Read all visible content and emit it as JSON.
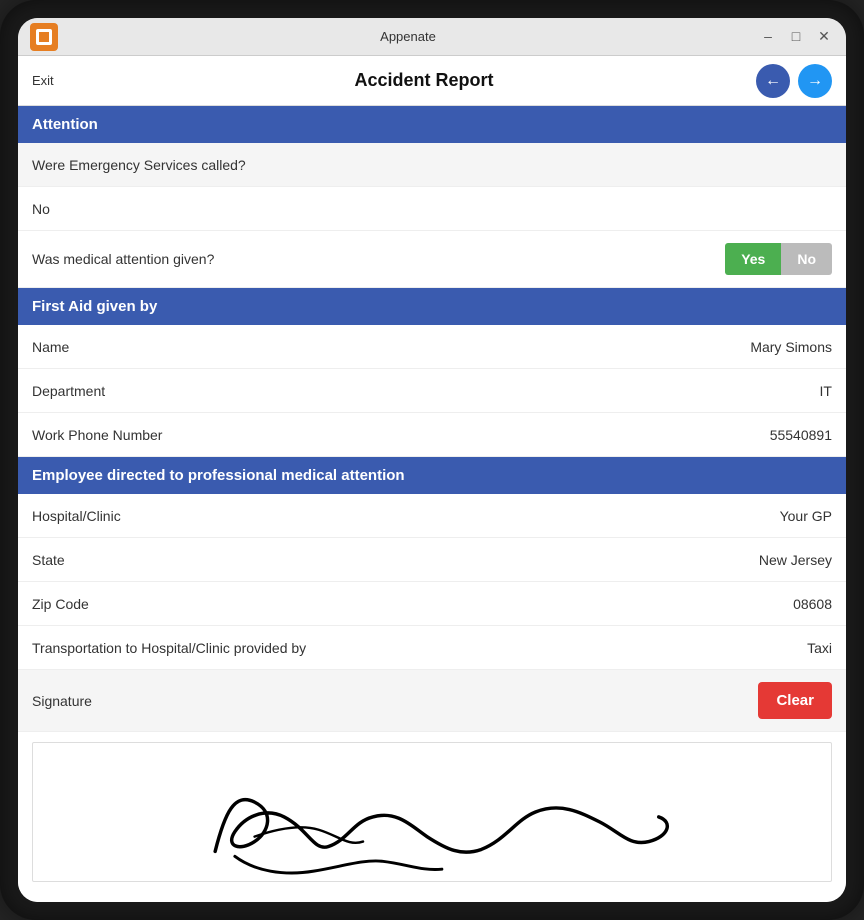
{
  "titleBar": {
    "appName": "Appenate",
    "controls": {
      "minimize": "–",
      "maximize": "□",
      "close": "✕"
    }
  },
  "appHeader": {
    "exitLabel": "Exit",
    "title": "Accident Report",
    "prevArrow": "←",
    "nextArrow": "→"
  },
  "sections": [
    {
      "id": "attention",
      "header": "Attention",
      "fields": [
        {
          "id": "emergency-services",
          "label": "Were Emergency Services called?",
          "value": "No",
          "type": "text",
          "shaded": true
        },
        {
          "id": "medical-attention",
          "label": "Was medical attention given?",
          "value": null,
          "type": "yesno",
          "yesLabel": "Yes",
          "noLabel": "No",
          "selected": "yes",
          "shaded": false
        }
      ]
    },
    {
      "id": "first-aid",
      "header": "First Aid given by",
      "fields": [
        {
          "id": "name",
          "label": "Name",
          "value": "Mary Simons",
          "type": "text",
          "shaded": false
        },
        {
          "id": "department",
          "label": "Department",
          "value": "IT",
          "type": "text",
          "shaded": false
        },
        {
          "id": "work-phone",
          "label": "Work Phone Number",
          "value": "55540891",
          "type": "text",
          "shaded": false
        }
      ]
    },
    {
      "id": "medical-direction",
      "header": "Employee directed to professional medical attention",
      "fields": [
        {
          "id": "hospital-clinic",
          "label": "Hospital/Clinic",
          "value": "Your GP",
          "type": "text",
          "shaded": false
        },
        {
          "id": "state",
          "label": "State",
          "value": "New Jersey",
          "type": "text",
          "shaded": false
        },
        {
          "id": "zip-code",
          "label": "Zip Code",
          "value": "08608",
          "type": "text",
          "shaded": false
        },
        {
          "id": "transportation",
          "label": "Transportation to Hospital/Clinic provided by",
          "value": "Taxi",
          "type": "text",
          "shaded": false
        }
      ]
    }
  ],
  "signature": {
    "label": "Signature",
    "clearLabel": "Clear"
  },
  "colors": {
    "sectionHeader": "#3a5baf",
    "toggleYes": "#4caf50",
    "toggleNo": "#bdbdbd",
    "clearBtn": "#e53935",
    "navPrev": "#3a5baf",
    "navNext": "#2196f3"
  }
}
